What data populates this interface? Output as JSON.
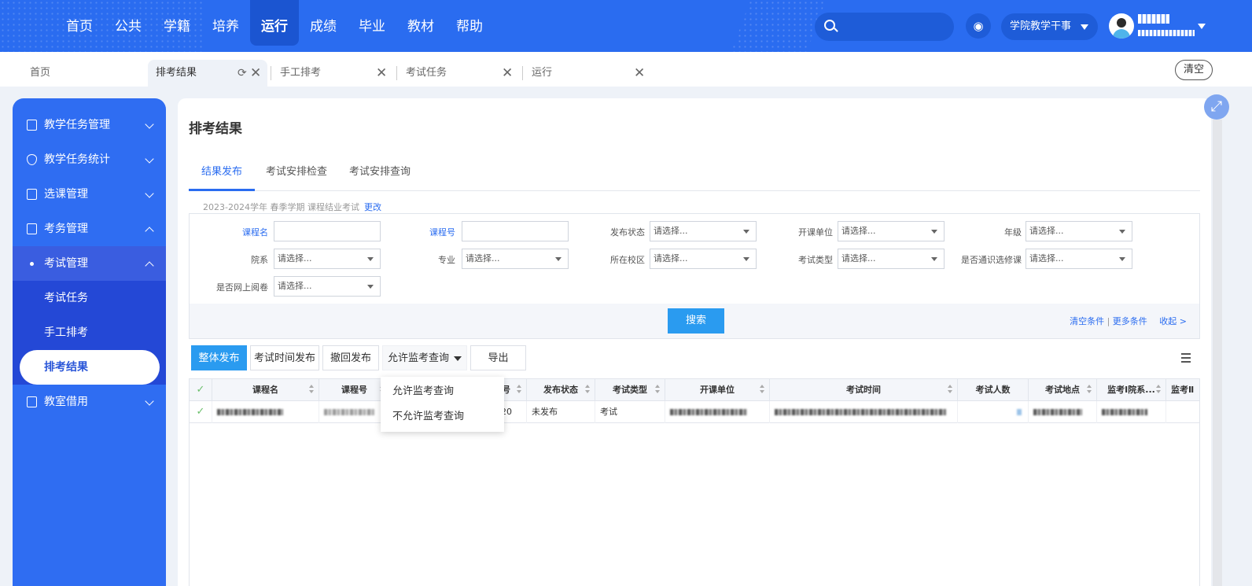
{
  "nav": {
    "items": [
      "首页",
      "公共",
      "学籍",
      "培养",
      "运行",
      "成绩",
      "毕业",
      "教材",
      "帮助"
    ],
    "active_index": 4
  },
  "header": {
    "search_placeholder": "",
    "role": "学院教学干事",
    "shirt_icon": "shirt-icon"
  },
  "tabs": {
    "items": [
      {
        "label": "首页"
      },
      {
        "label": "排考结果"
      },
      {
        "label": "手工排考"
      },
      {
        "label": "考试任务"
      },
      {
        "label": "运行"
      }
    ],
    "clear_label": "清空"
  },
  "sidebar": {
    "items": [
      {
        "label": "教学任务管理"
      },
      {
        "label": "教学任务统计"
      },
      {
        "label": "选课管理"
      },
      {
        "label": "考务管理"
      },
      {
        "label": "考试管理"
      },
      {
        "label": "考试任务"
      },
      {
        "label": "手工排考"
      },
      {
        "label": "排考结果"
      },
      {
        "label": "教室借用"
      }
    ]
  },
  "page": {
    "title": "排考结果",
    "subtabs": [
      "结果发布",
      "考试安排检查",
      "考试安排查询"
    ],
    "term_text": "2023-2024学年 春季学期 课程结业考试",
    "term_change": "更改"
  },
  "filter": {
    "labels": {
      "course_name": "课程名",
      "course_no": "课程号",
      "publish_status": "发布状态",
      "dept": "开课单位",
      "grade": "年级",
      "faculty": "院系",
      "major": "专业",
      "campus": "所在校区",
      "exam_type": "考试类型",
      "general_elective": "是否通识选修课",
      "online_marking": "是否网上阅卷"
    },
    "select_placeholder": "请选择...",
    "search_label": "搜索",
    "clear_conditions": "清空条件",
    "more_conditions": "更多条件",
    "collapse": "收起 >"
  },
  "toolbar": {
    "publish_all": "整体发布",
    "publish_time": "考试时间发布",
    "revoke": "撤回发布",
    "allow_query": "允许监考查询",
    "export": "导出"
  },
  "dropdown": {
    "options": [
      "允许监考查询",
      "不允许监考查询"
    ]
  },
  "table": {
    "headers": {
      "course_name": "课程名",
      "course_no": "课程号",
      "seq": "号",
      "publish_status": "发布状态",
      "exam_type": "考试类型",
      "dept": "开课单位",
      "exam_time": "考试时间",
      "exam_count": "考试人数",
      "exam_place": "考试地点",
      "proctor1": "监考Ⅰ院系...",
      "proctor2": "监考Ⅱ"
    },
    "row": {
      "seq": "20",
      "publish_status": "未发布",
      "exam_type": "考试"
    }
  }
}
